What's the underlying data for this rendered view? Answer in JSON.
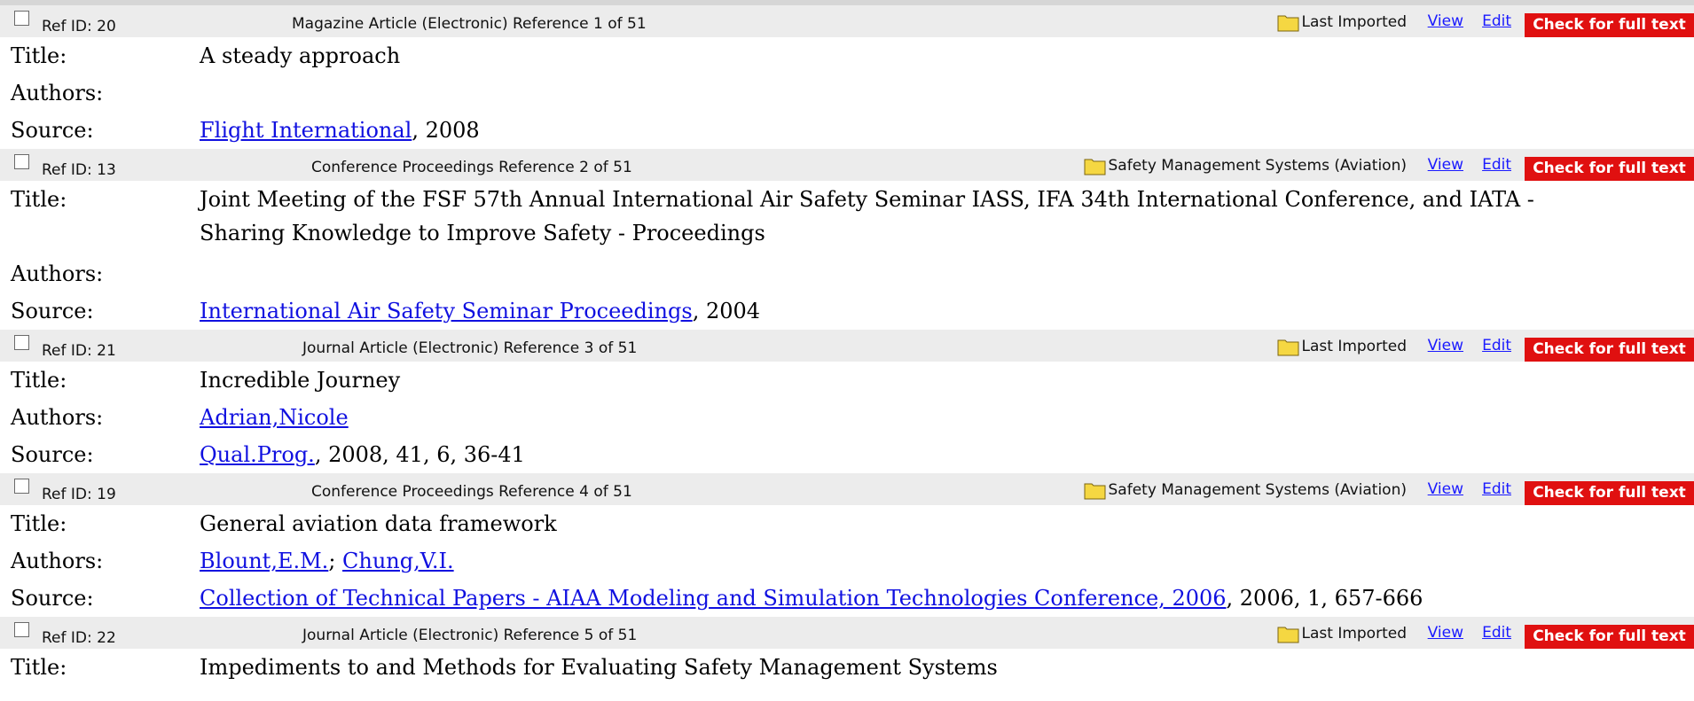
{
  "labels": {
    "title": "Title:",
    "authors": "Authors:",
    "source": "Source:"
  },
  "actions": {
    "view": "View",
    "edit": "Edit",
    "full_text": "Check for full text"
  },
  "colors": {
    "header_bg": "#ececec",
    "link": "#1010e0",
    "full_text_button": "#e01010",
    "folder": "#f5d742"
  },
  "references": [
    {
      "ref_id": "Ref ID: 20",
      "type_line": "Magazine Article (Electronic) Reference 1 of 51",
      "folder": "Last Imported",
      "title": "A steady approach",
      "authors": [],
      "source_link": "Flight International",
      "source_rest": ", 2008"
    },
    {
      "ref_id": "Ref ID: 13",
      "type_line": "Conference Proceedings Reference 2 of 51",
      "folder": "Safety Management Systems (Aviation)",
      "title": "Joint Meeting of the FSF 57th Annual International Air Safety Seminar IASS, IFA 34th International Conference, and IATA - Sharing Knowledge to Improve Safety - Proceedings",
      "authors": [],
      "source_link": "International Air Safety Seminar Proceedings",
      "source_rest": ", 2004"
    },
    {
      "ref_id": "Ref ID: 21",
      "type_line": "Journal Article (Electronic) Reference 3 of 51",
      "folder": "Last Imported",
      "title": "Incredible Journey",
      "authors": [
        "Adrian,Nicole"
      ],
      "source_link": "Qual.Prog.",
      "source_rest": ", 2008, 41, 6, 36-41"
    },
    {
      "ref_id": "Ref ID: 19",
      "type_line": "Conference Proceedings Reference 4 of 51",
      "folder": "Safety Management Systems (Aviation)",
      "title": "General aviation data framework",
      "authors": [
        "Blount,E.M.",
        "Chung,V.I."
      ],
      "source_link": "Collection of Technical Papers - AIAA Modeling and Simulation Technologies Conference, 2006",
      "source_rest": ", 2006, 1, 657-666"
    },
    {
      "ref_id": "Ref ID: 22",
      "type_line": "Journal Article (Electronic) Reference 5 of 51",
      "folder": "Last Imported",
      "title": "Impediments to and Methods for Evaluating Safety Management Systems"
    }
  ]
}
